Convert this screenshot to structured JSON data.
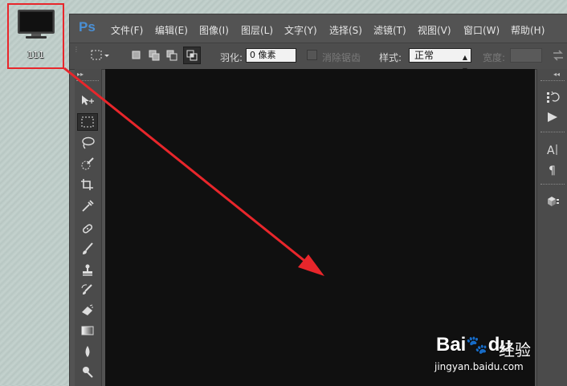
{
  "desktop": {
    "icon_label": "111"
  },
  "app": {
    "logo": "Ps",
    "menus": [
      "文件(F)",
      "编辑(E)",
      "图像(I)",
      "图层(L)",
      "文字(Y)",
      "选择(S)",
      "滤镜(T)",
      "视图(V)",
      "窗口(W)",
      "帮助(H)"
    ]
  },
  "options": {
    "feather_label": "羽化:",
    "feather_value": "0 像素",
    "antialias_label": "消除锯齿",
    "style_label": "样式:",
    "style_value": "正常",
    "width_label": "宽度:"
  },
  "toolbox": {
    "tools": [
      "move-tool",
      "rectangular-marquee-tool",
      "lasso-tool",
      "quick-selection-tool",
      "crop-tool",
      "eyedropper-tool",
      "spot-healing-brush-tool",
      "brush-tool",
      "clone-stamp-tool",
      "history-brush-tool",
      "eraser-tool",
      "gradient-tool",
      "blur-tool",
      "dodge-tool"
    ],
    "active_tool": "rectangular-marquee-tool"
  },
  "right_dock": {
    "panels": [
      "history-panel-icon",
      "actions-panel-icon",
      "character-panel-icon",
      "paragraph-panel-icon",
      "3d-panel-icon"
    ]
  },
  "annotation": {
    "highlight_color": "#e8262b"
  },
  "watermark": {
    "brand": "Bai",
    "brand_tail": "du",
    "sub": "经验",
    "url": "jingyan.baidu.com"
  }
}
